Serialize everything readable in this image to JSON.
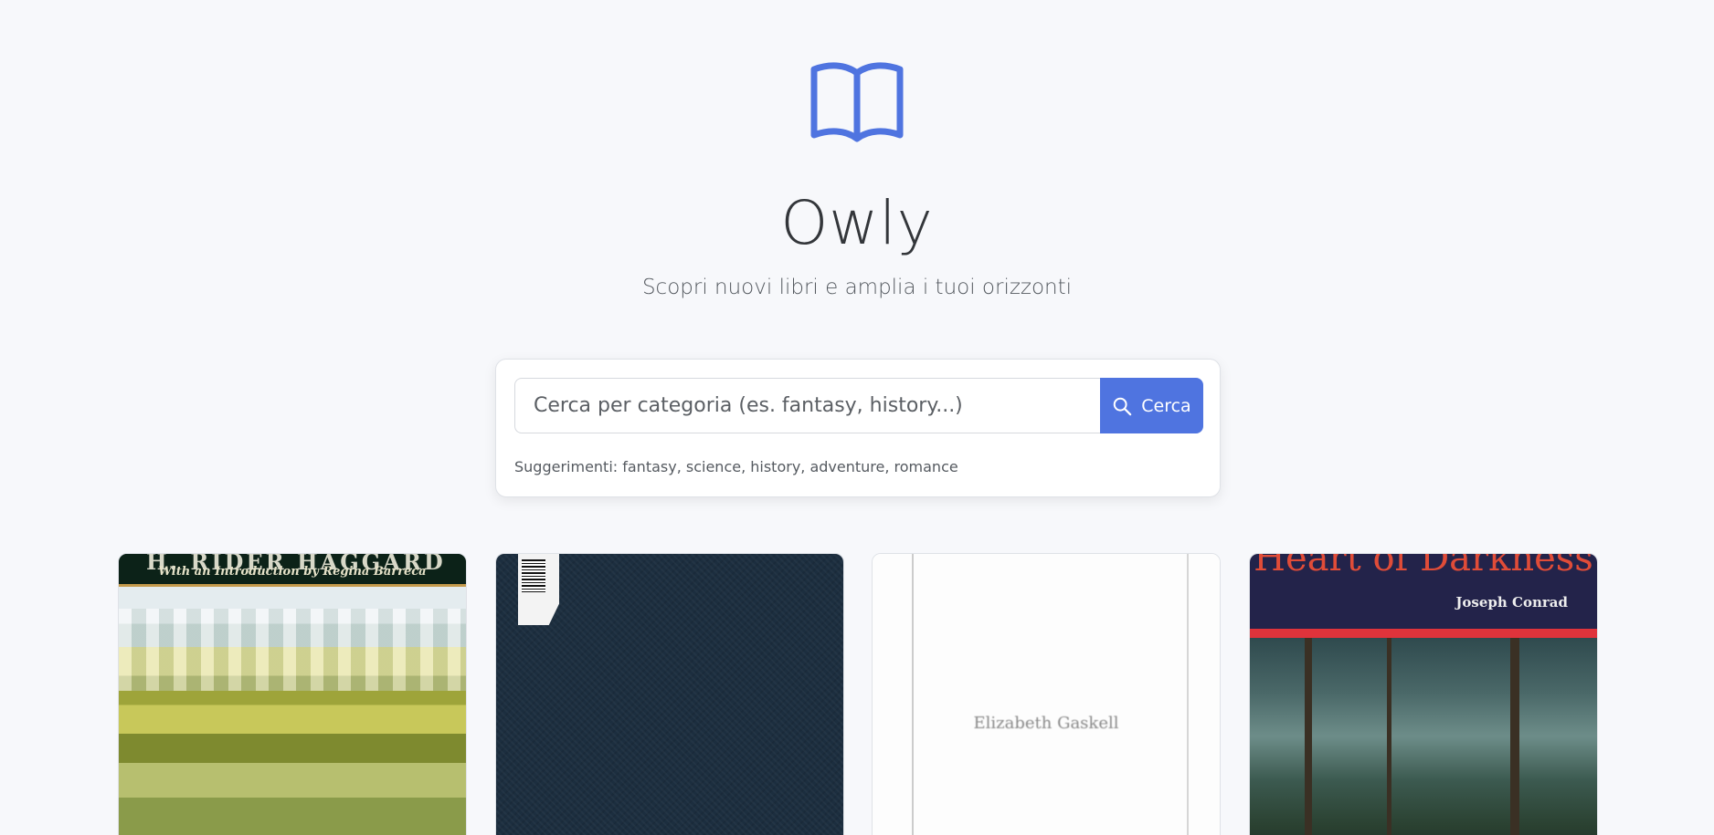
{
  "app": {
    "name": "Owly",
    "tagline": "Scopri nuovi libri e amplia i tuoi orizzonti",
    "logo_icon": "open-book-icon",
    "accent_color": "#4f74e0",
    "background_color": "#f7f8fb"
  },
  "search": {
    "placeholder": "Cerca per categoria (es. fantasy, history...)",
    "value": "",
    "button_label": "Cerca",
    "button_icon": "search-icon",
    "suggestions_text": "Suggerimenti: fantasy, science, history, adventure, romance"
  },
  "books": [
    {
      "cover_text_top": "H. RIDER HAGGARD",
      "cover_text_sub": "With an Introduction by Regina Barreca"
    },
    {
      "cover_text_top": "3 1 7"
    },
    {
      "cover_text_top": "Elizabeth Gaskell"
    },
    {
      "cover_text_top": "Heart of Darkness",
      "cover_text_sub": "Joseph Conrad"
    }
  ]
}
